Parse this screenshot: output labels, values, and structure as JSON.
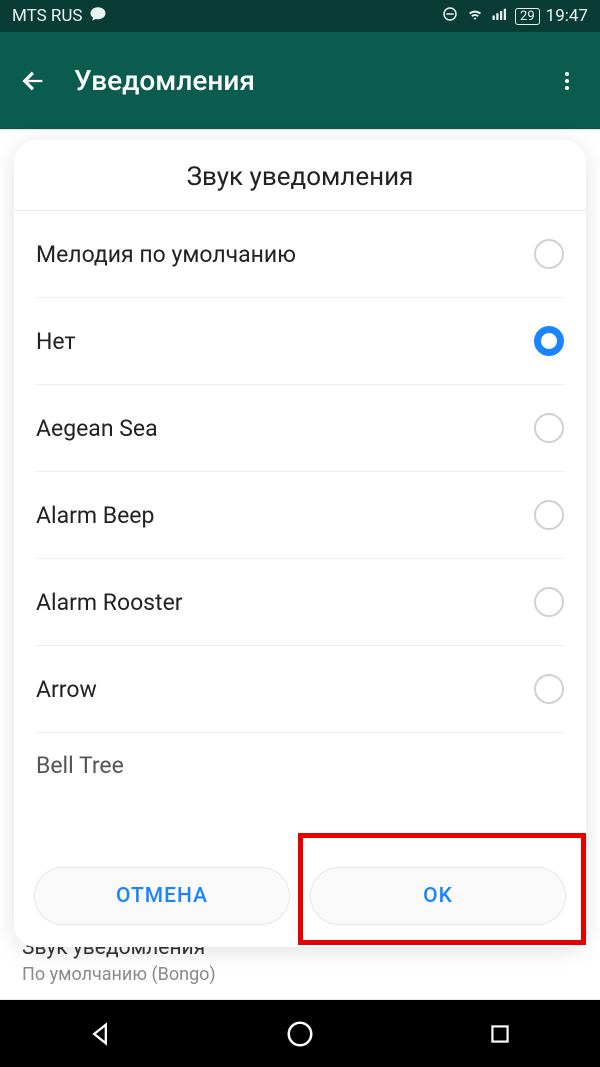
{
  "status": {
    "carrier": "MTS RUS",
    "battery": "29",
    "time": "19:47"
  },
  "appbar": {
    "title": "Уведомления"
  },
  "background_setting": {
    "title": "Звук уведомления",
    "value": "По умолчанию (Bongo)"
  },
  "dialog": {
    "title": "Звук уведомления",
    "options": [
      {
        "label": "Мелодия по умолчанию",
        "selected": false
      },
      {
        "label": "Нет",
        "selected": true
      },
      {
        "label": "Aegean Sea",
        "selected": false
      },
      {
        "label": "Alarm Beep",
        "selected": false
      },
      {
        "label": "Alarm Rooster",
        "selected": false
      },
      {
        "label": "Arrow",
        "selected": false
      },
      {
        "label": "Bell Tree",
        "selected": false
      }
    ],
    "cancel_label": "ОТМЕНА",
    "ok_label": "OK"
  }
}
